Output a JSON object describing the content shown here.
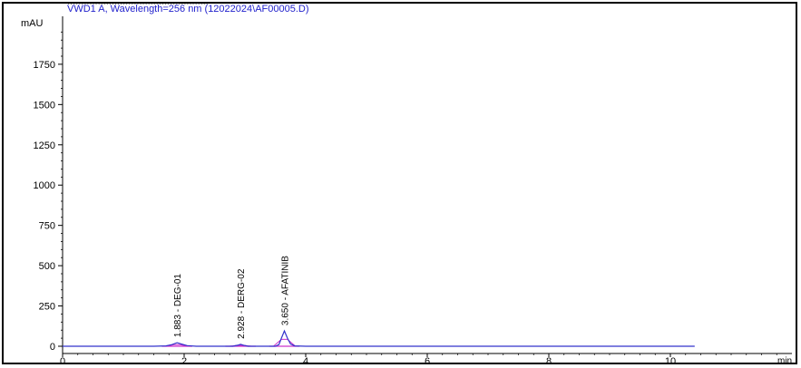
{
  "header": {
    "signal_title": "VWD1 A, Wavelength=256 nm (12022024\\AF00005.D)",
    "clipped_line": "..................................................."
  },
  "chart_data": {
    "type": "line",
    "title": "",
    "xlabel": "min",
    "ylabel": "mAU",
    "xlim": [
      0,
      12
    ],
    "ylim": [
      -30,
      2000
    ],
    "x_ticks": [
      0,
      2,
      4,
      6,
      8,
      10
    ],
    "x_tick_labels": [
      "0",
      "2",
      "4",
      "6",
      "8",
      "10"
    ],
    "y_ticks": [
      0,
      250,
      500,
      750,
      1000,
      1250,
      1500,
      1750
    ],
    "y_tick_labels": [
      "0",
      "250",
      "500",
      "750",
      "1000",
      "1250",
      "1500",
      "1750"
    ],
    "grid": false,
    "colors": {
      "signal": "#3333cc",
      "integration": "#cc33cc",
      "title_text": "#2222cc",
      "axis": "#000000"
    },
    "peaks": [
      {
        "rt": 1.883,
        "height": 22,
        "label": "1.883 - DEG-01"
      },
      {
        "rt": 2.928,
        "height": 12,
        "label": "2.928 - DERG-02"
      },
      {
        "rt": 3.65,
        "height": 95,
        "label": "3.650 - AFATINIB"
      }
    ],
    "series": [
      {
        "x": [
          0,
          1.5,
          1.7,
          1.8,
          1.883,
          1.95,
          2.05,
          2.2,
          2.8,
          2.88,
          2.928,
          2.98,
          3.05,
          3.5,
          3.56,
          3.6,
          3.65,
          3.7,
          3.75,
          3.82,
          4.0,
          6.0,
          8.0,
          10.0,
          10.4
        ],
        "y": [
          0,
          0,
          2,
          10,
          22,
          14,
          4,
          0,
          0,
          6,
          12,
          6,
          0,
          0,
          10,
          50,
          95,
          50,
          14,
          2,
          0,
          0,
          0,
          0,
          0
        ]
      }
    ]
  }
}
